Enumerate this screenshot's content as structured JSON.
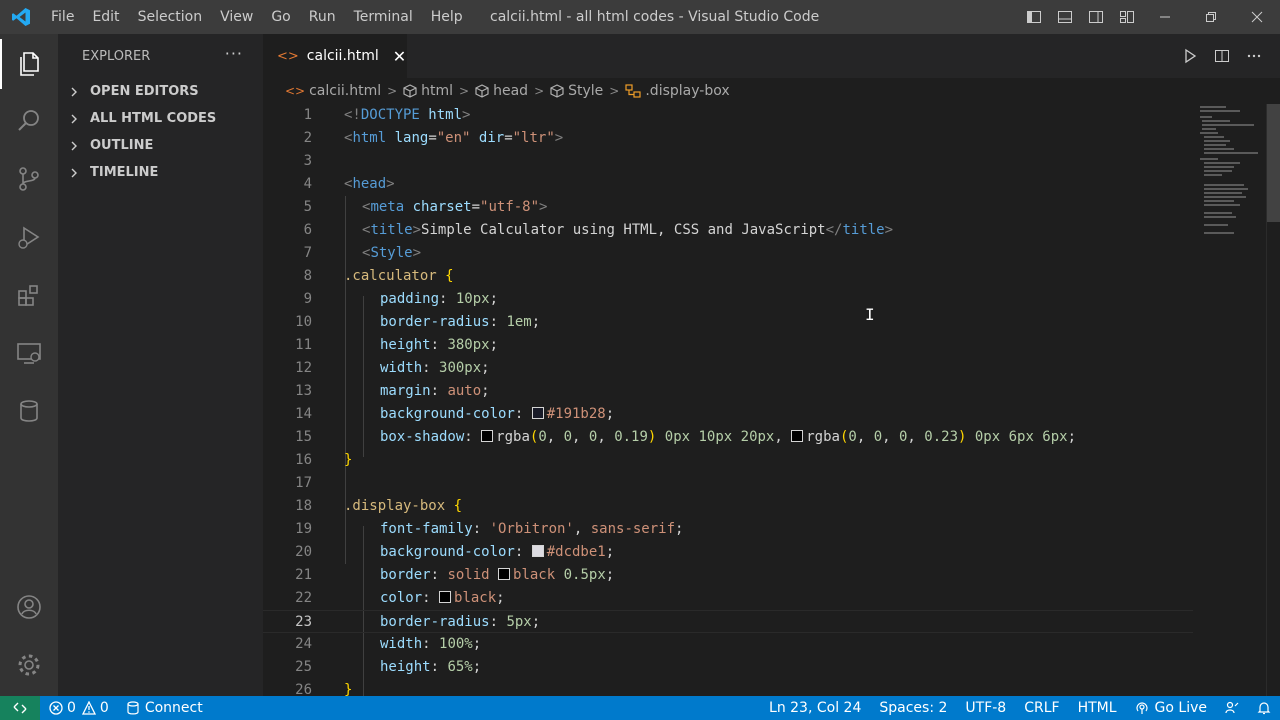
{
  "menu": [
    "File",
    "Edit",
    "Selection",
    "View",
    "Go",
    "Run",
    "Terminal",
    "Help"
  ],
  "window_title": "calcii.html - all html codes - Visual Studio Code",
  "sidebar": {
    "header": "EXPLORER",
    "more": "···",
    "sections": [
      "OPEN EDITORS",
      "ALL HTML CODES",
      "OUTLINE",
      "TIMELINE"
    ]
  },
  "tab": {
    "label": "calcii.html",
    "close": "✕"
  },
  "breadcrumb": [
    "calcii.html",
    "html",
    "head",
    "Style",
    ".display-box"
  ],
  "editor": {
    "line_numbers": [
      "1",
      "2",
      "3",
      "4",
      "5",
      "6",
      "7",
      "8",
      "9",
      "10",
      "11",
      "12",
      "13",
      "14",
      "15",
      "16",
      "17",
      "18",
      "19",
      "20",
      "21",
      "22",
      "23",
      "24",
      "25",
      "26"
    ],
    "current_line": 23,
    "lines": {
      "l1": {
        "a": "<!",
        "b": "DOCTYPE",
        "c": " html",
        "d": ">"
      },
      "l2": {
        "a": "<",
        "b": "html",
        "c": " lang",
        "d": "=",
        "e": "\"en\"",
        "f": " dir",
        "g": "=",
        "h": "\"ltr\"",
        "i": ">"
      },
      "l4": {
        "a": "<",
        "b": "head",
        "c": ">"
      },
      "l5": {
        "a": "<",
        "b": "meta",
        "c": " charset",
        "d": "=",
        "e": "\"utf-8\"",
        "f": ">"
      },
      "l6": {
        "a": "<",
        "b": "title",
        "c": ">",
        "d": "Simple Calculator using HTML, CSS and JavaScript",
        "e": "</",
        "f": "title",
        "g": ">"
      },
      "l7": {
        "a": "<",
        "b": "Style",
        "c": ">"
      },
      "l8": {
        "a": ".calculator",
        "b": " {"
      },
      "l9": {
        "a": "padding",
        "b": ": ",
        "c": "10px",
        "d": ";"
      },
      "l10": {
        "a": "border-radius",
        "b": ": ",
        "c": "1em",
        "d": ";"
      },
      "l11": {
        "a": "height",
        "b": ": ",
        "c": "380px",
        "d": ";"
      },
      "l12": {
        "a": "width",
        "b": ": ",
        "c": "300px",
        "d": ";"
      },
      "l13": {
        "a": "margin",
        "b": ": ",
        "c": "auto",
        "d": ";"
      },
      "l14": {
        "a": "background-color",
        "b": ": ",
        "c": "#191b28",
        "d": ";"
      },
      "l15": {
        "a": "box-shadow",
        "b": ": ",
        "c": "rgba",
        "d": "(",
        "e": "0",
        "f": ", ",
        "g": "0",
        "h": ", ",
        "i": "0",
        "j": ", ",
        "k": "0.19",
        "l": ")",
        "m": " 0px 10px 20px",
        "n": ", ",
        "o": "rgba",
        "p": "(",
        "q": "0",
        "r": ", ",
        "s": "0",
        "t": ", ",
        "u": "0",
        "v": ", ",
        "w": "0.23",
        "x": ")",
        "y": " 0px 6px 6px",
        "z": ";"
      },
      "l16": {
        "a": "}"
      },
      "l18": {
        "a": ".display-box",
        "b": " {"
      },
      "l19": {
        "a": "font-family",
        "b": ": ",
        "c": "'Orbitron'",
        "d": ", ",
        "e": "sans-serif",
        "f": ";"
      },
      "l20": {
        "a": "background-color",
        "b": ": ",
        "c": "#dcdbe1",
        "d": ";"
      },
      "l21": {
        "a": "border",
        "b": ": ",
        "c": "solid ",
        "d": "black",
        "e": " 0.5px",
        "f": ";"
      },
      "l22": {
        "a": "color",
        "b": ": ",
        "c": "black",
        "d": ";"
      },
      "l23": {
        "a": "border-radius",
        "b": ": ",
        "c": "5px",
        "d": ";"
      },
      "l24": {
        "a": "width",
        "b": ": ",
        "c": "100%",
        "d": ";"
      },
      "l25": {
        "a": "height",
        "b": ": ",
        "c": "65%",
        "d": ";"
      },
      "l26": {
        "a": "}"
      }
    },
    "swatches": {
      "calc_bg": "#191b28",
      "shadow": "#000000",
      "display_bg": "#dcdbe1",
      "black": "#000000"
    }
  },
  "statusbar": {
    "errors": "0",
    "warnings": "0",
    "connect": "Connect",
    "position": "Ln 23, Col 24",
    "spaces": "Spaces: 2",
    "encoding": "UTF-8",
    "eol": "CRLF",
    "language": "HTML",
    "golive": "Go Live"
  },
  "colors": {
    "titlebar": "#3c3c3c",
    "activitybar": "#333333",
    "sidebar": "#252526",
    "editor": "#1e1e1e",
    "statusbar": "#007acc",
    "remote": "#16825d"
  },
  "icons": {
    "activity": [
      "files-icon",
      "search-icon",
      "source-control-icon",
      "run-debug-icon",
      "extensions-icon",
      "remote-explorer-icon",
      "database-icon",
      "account-icon",
      "settings-gear-icon"
    ],
    "editor_actions": [
      "run-icon",
      "split-editor-icon",
      "more-actions-icon"
    ]
  }
}
